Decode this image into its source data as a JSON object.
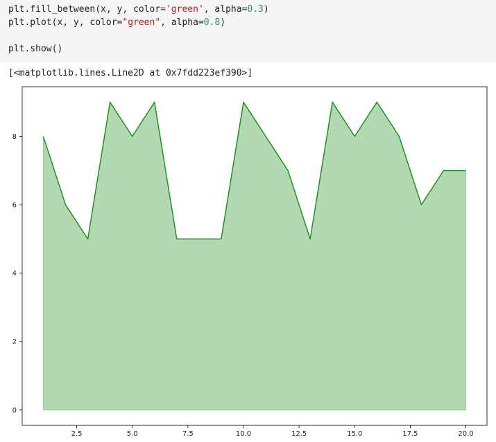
{
  "code": {
    "line1": {
      "pre": "plt.fill_between(x, y, color=",
      "str": "'green'",
      "mid": ", alpha=",
      "num": "0.3",
      "post": ")"
    },
    "line2": {
      "pre": "plt.plot(x, y, color=",
      "str": "\"green\"",
      "mid": ", alpha=",
      "num": "0.8",
      "post": ")"
    },
    "line3": {
      "text": "plt.show()"
    }
  },
  "output": {
    "text": "[<matplotlib.lines.Line2D at 0x7fdd223ef390>]"
  },
  "chart_data": {
    "type": "area",
    "x": [
      1,
      2,
      3,
      4,
      5,
      6,
      7,
      8,
      9,
      10,
      11,
      12,
      13,
      14,
      15,
      16,
      17,
      18,
      19,
      20
    ],
    "series": [
      {
        "values": [
          8,
          6,
          5,
          9,
          8,
          9,
          5,
          5,
          5,
          9,
          8,
          7,
          5,
          9,
          8,
          9,
          8,
          6,
          7,
          7
        ]
      }
    ],
    "xlim": [
      0.05,
      20.95
    ],
    "ylim": [
      -0.45,
      9.45
    ],
    "xticks": [
      "2.5",
      "5.0",
      "7.5",
      "10.0",
      "12.5",
      "15.0",
      "17.5",
      "20.0"
    ],
    "yticks": [
      "0",
      "2",
      "4",
      "6",
      "8"
    ],
    "colors": {
      "line": "#008000",
      "fill": "#008000"
    },
    "line_alpha": 0.8,
    "fill_alpha": 0.3,
    "grid": false
  }
}
